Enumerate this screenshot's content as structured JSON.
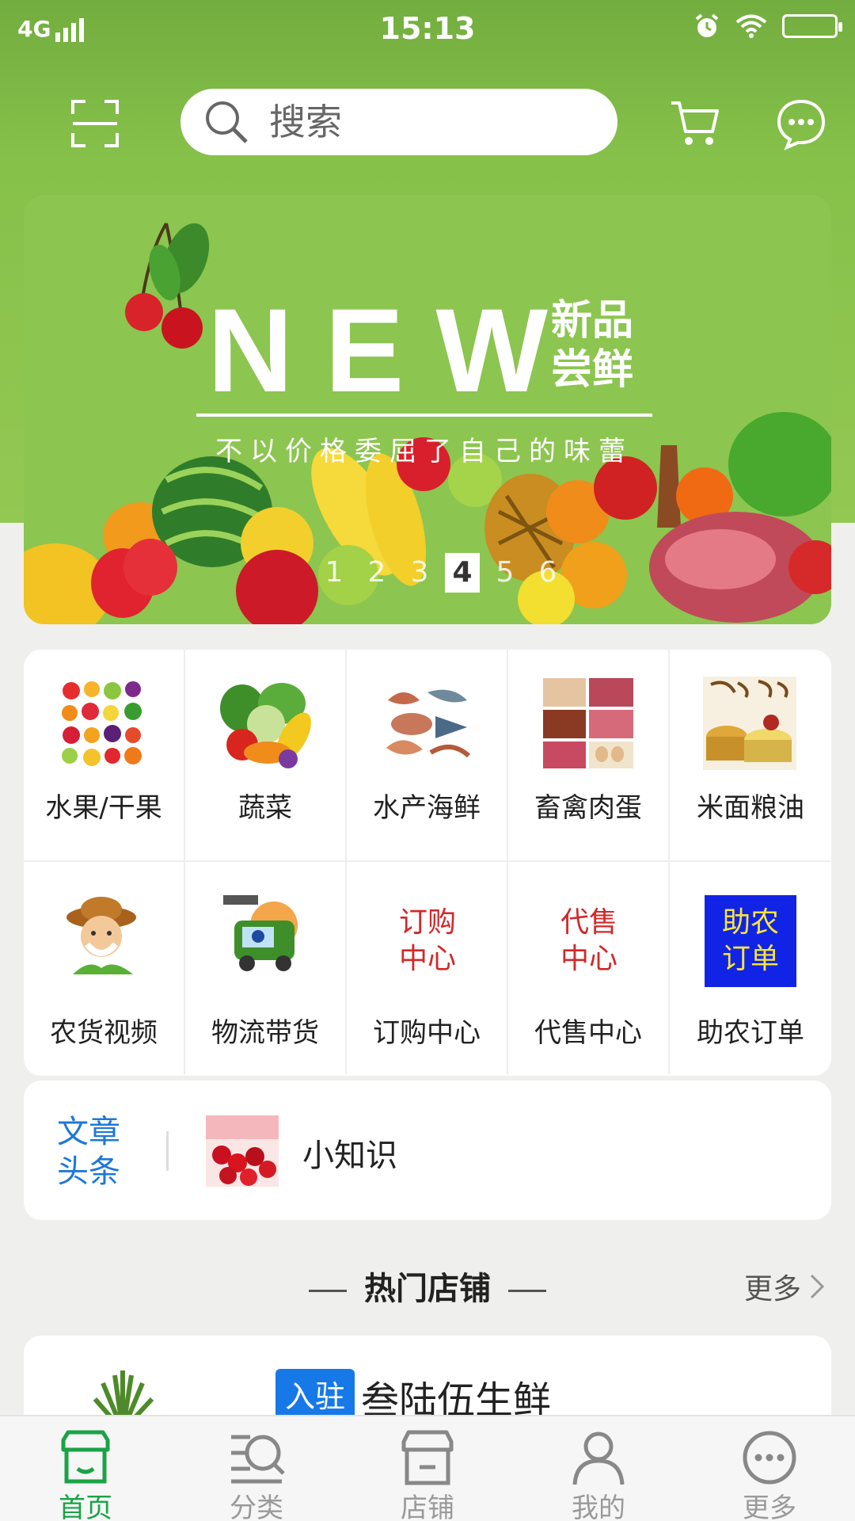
{
  "status_bar": {
    "network": "4G",
    "time": "15:13"
  },
  "header": {
    "search_placeholder": "搜索",
    "icons": [
      "scan-icon",
      "search-icon",
      "cart-icon",
      "message-icon"
    ]
  },
  "banner": {
    "headline": "NEW",
    "subtitle": "新品尝鲜",
    "slogan": "不以价格委屈了自己的味蕾",
    "pages": [
      "1",
      "2",
      "3",
      "4",
      "5",
      "6"
    ],
    "active_page": "4"
  },
  "categories": [
    {
      "label": "水果/干果",
      "icon": "fruit-icon"
    },
    {
      "label": "蔬菜",
      "icon": "vegetable-icon"
    },
    {
      "label": "水产海鲜",
      "icon": "seafood-icon"
    },
    {
      "label": "畜禽肉蛋",
      "icon": "meat-egg-icon"
    },
    {
      "label": "米面粮油",
      "icon": "grain-oil-icon"
    },
    {
      "label": "农货视频",
      "icon": "farmer-video-icon"
    },
    {
      "label": "物流带货",
      "icon": "logistics-truck-icon"
    },
    {
      "label": "订购中心",
      "tile_text": "订购\n中心",
      "tile_top": "订购",
      "tile_bottom": "中心"
    },
    {
      "label": "代售中心",
      "tile_text": "代售\n中心",
      "tile_top": "代售",
      "tile_bottom": "中心"
    },
    {
      "label": "助农订单",
      "tile_top": "助农",
      "tile_bottom": "订单"
    }
  ],
  "news": {
    "tag_line1": "文章",
    "tag_line2": "头条",
    "title": "小知识"
  },
  "hot_shops": {
    "title": "热门店铺",
    "more": "更多",
    "shops": [
      {
        "badge": "入驻",
        "name": "叁陆伍生鲜"
      }
    ]
  },
  "bottom_nav": [
    {
      "label": "首页",
      "icon": "home-store-icon",
      "active": true
    },
    {
      "label": "分类",
      "icon": "category-icon",
      "active": false
    },
    {
      "label": "店铺",
      "icon": "shop-icon",
      "active": false
    },
    {
      "label": "我的",
      "icon": "profile-icon",
      "active": false
    },
    {
      "label": "更多",
      "icon": "more-icon",
      "active": false
    }
  ],
  "colors": {
    "brand_green": "#86c14a",
    "active_nav": "#1aa346",
    "news_tag": "#1e78d8",
    "badge_blue": "#1779e8"
  }
}
